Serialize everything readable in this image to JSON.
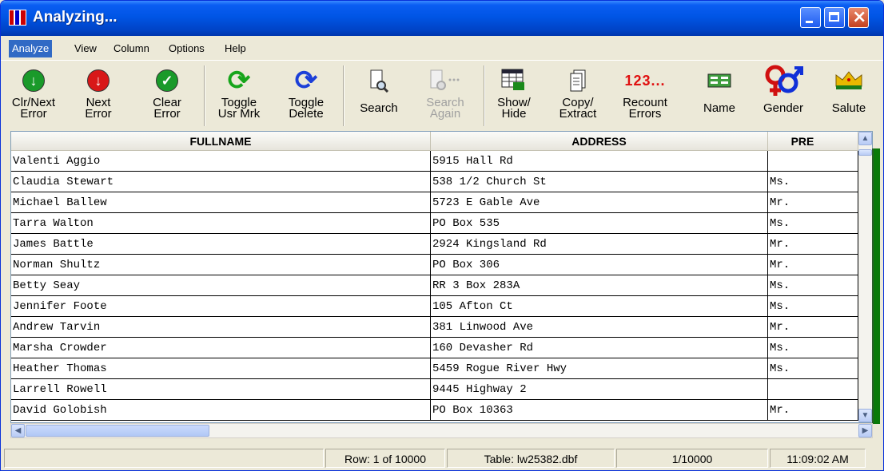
{
  "window": {
    "title": "Analyzing..."
  },
  "menu": [
    "Analyze",
    "View",
    "Column",
    "Options",
    "Help"
  ],
  "toolbar": {
    "buttons": [
      {
        "label": "Clr/Next\nError",
        "icon": "green-down-arrow-icon"
      },
      {
        "label": "Next\nError",
        "icon": "red-down-arrow-icon"
      },
      {
        "label": "Clear\nError",
        "icon": "green-check-icon"
      },
      {
        "label": "Toggle\nUsr Mrk",
        "icon": "green-refresh-icon"
      },
      {
        "label": "Toggle\nDelete",
        "icon": "blue-refresh-icon"
      },
      {
        "label": "Search",
        "icon": "search-icon"
      },
      {
        "label": "Search\nAgain",
        "icon": "search-again-icon",
        "disabled": true
      },
      {
        "label": "Show/\nHide",
        "icon": "show-hide-icon"
      },
      {
        "label": "Copy/\nExtract",
        "icon": "copy-icon"
      },
      {
        "label": "Recount\nErrors",
        "icon": "recount-icon",
        "icon_text": "123..."
      },
      {
        "label": "Name",
        "icon": "name-icon"
      },
      {
        "label": "Gender",
        "icon": "gender-icon"
      },
      {
        "label": "Salute",
        "icon": "crown-icon"
      }
    ]
  },
  "table": {
    "columns": [
      "FULLNAME",
      "ADDRESS",
      "PRE"
    ],
    "rows": [
      [
        "Valenti Aggio",
        "5915 Hall Rd",
        ""
      ],
      [
        "Claudia Stewart",
        "538 1/2 Church St",
        "Ms."
      ],
      [
        "Michael Ballew",
        "5723 E Gable Ave",
        "Mr."
      ],
      [
        "Tarra Walton",
        "PO Box 535",
        "Ms."
      ],
      [
        "James Battle",
        "2924 Kingsland Rd",
        "Mr."
      ],
      [
        "Norman Shultz",
        "PO Box 306",
        "Mr."
      ],
      [
        "Betty Seay",
        "RR 3 Box 283A",
        "Ms."
      ],
      [
        "Jennifer Foote",
        "105 Afton Ct",
        "Ms."
      ],
      [
        "Andrew Tarvin",
        "381 Linwood Ave",
        "Mr."
      ],
      [
        "Marsha Crowder",
        "160 Devasher Rd",
        "Ms."
      ],
      [
        "Heather Thomas",
        "5459 Rogue River Hwy",
        "Ms."
      ],
      [
        "Larrell Rowell",
        "9445 Highway 2",
        ""
      ],
      [
        "David Golobish",
        "PO Box 10363",
        "Mr."
      ]
    ]
  },
  "status": {
    "row": "Row: 1 of 10000",
    "table": "Table: lw25382.dbf",
    "count": "1/10000",
    "time": "11:09:02 AM"
  }
}
